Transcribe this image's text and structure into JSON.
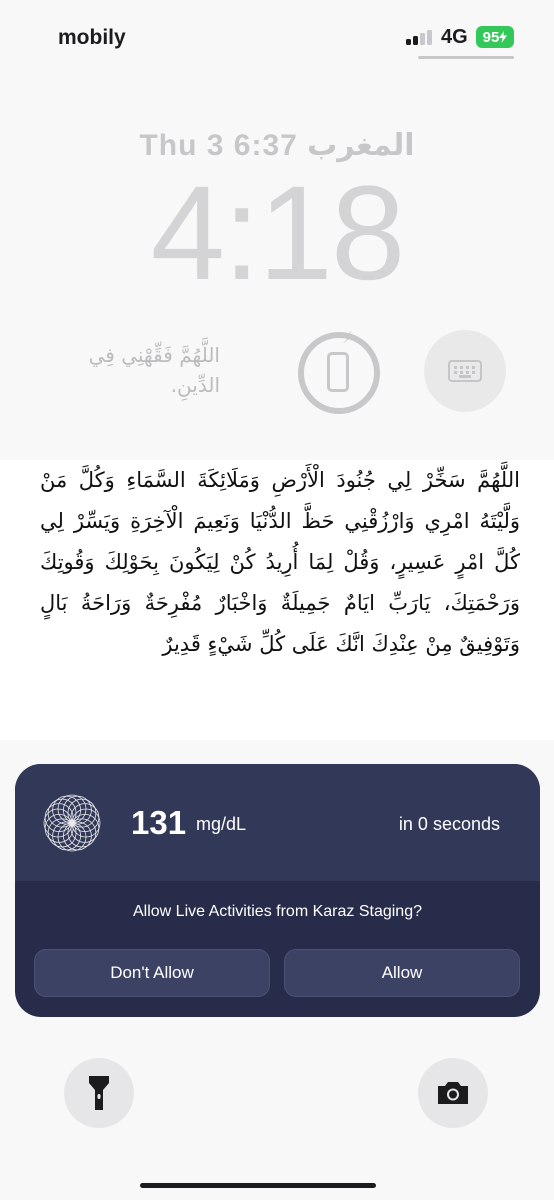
{
  "status_bar": {
    "carrier": "mobily",
    "network": "4G",
    "battery": "95"
  },
  "lock_screen": {
    "date_line": "Thu 3  6:37 المغرب",
    "time": "4:18",
    "dua_widget": "اللَّهُمَّ فَقِّهْنِي فِي الدِّينِ."
  },
  "wallpaper_text": "اللَّهُمَّ سَخِّرْ لِي جُنُودَ الْأَرْضِ وَمَلَائِكَةَ السَّمَاءِ وَكُلَّ مَنْ وَلَّيْتَهُ امْرِي وَارْزُقْنِي حَظَّ الدُّنْيَا وَنَعِيمَ الْآخِرَةِ وَيَسِّرْ لِي كُلَّ امْرٍ عَسِيرٍ، وَقُلْ لِمَا أُرِيدُ كُنْ لِيَكُونَ بِحَوْلِكَ وَقُوتِكَ وَرَحْمَتِكَ، يَارَبِّ ايَامٌ جَمِيلَةٌ وَاخْبَارٌ مُفْرِحَةٌ وَرَاحَةُ بَالٍ وَتَوْفِيقٌ مِنْ عِنْدِكَ انَّكَ عَلَى كُلِّ شَيْءٍ قَدِيرٌ",
  "live_activity": {
    "reading": "131",
    "unit": "mg/dL",
    "timer": "in 0 seconds",
    "question": "Allow Live Activities from Karaz Staging?",
    "deny_label": "Don't Allow",
    "allow_label": "Allow"
  },
  "controls": {
    "flashlight_icon": "flashlight-icon",
    "camera_icon": "camera-icon"
  },
  "colors": {
    "battery": "#34c759",
    "prompt_bg": "#272c4a",
    "prompt_header": "#323857"
  }
}
